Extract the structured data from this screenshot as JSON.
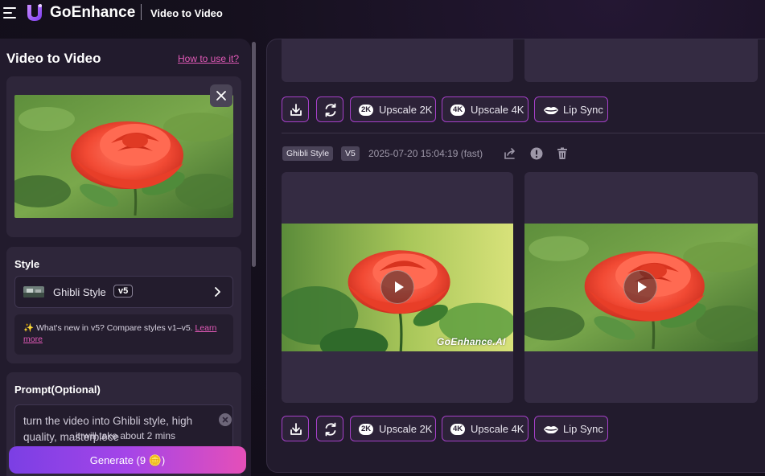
{
  "app": {
    "brand": "GoEnhance",
    "breadcrumb": "Video to Video"
  },
  "left_panel": {
    "title": "Video to Video",
    "how_to_link": "How to use it?",
    "style_section": {
      "label": "Style",
      "selected_style": "Ghibli Style",
      "version_badge": "v5",
      "news_text": "✨ What's new in v5? Compare styles v1–v5. ",
      "news_link": "Learn more"
    },
    "prompt_section": {
      "label": "Prompt(Optional)",
      "value": "turn the video into Ghibli style, high quality, masterpiece"
    },
    "time_hint": "it will take about 2 mins",
    "generate_button": "Generate (9 🪙)"
  },
  "right_panel": {
    "action_buttons": {
      "download_icon": "download-icon",
      "regenerate_icon": "refresh-icon",
      "upscale_2k": "Upscale 2K",
      "upscale_2k_badge": "2K",
      "upscale_4k": "Upscale 4K",
      "upscale_4k_badge": "4K",
      "lip_sync": "Lip Sync"
    },
    "result": {
      "style_tag": "Ghibli Style",
      "version_tag": "V5",
      "timestamp": "2025-07-20 15:04:19 (fast)",
      "watermark": "GoEnhance.AI"
    }
  },
  "colors": {
    "accent_border": "#a540c8",
    "link": "#e25ab8",
    "generate_gradient_start": "#7b3fe4",
    "generate_gradient_end": "#e54fb8",
    "panel_bg": "#221b2d",
    "card_bg": "#2e263a"
  }
}
